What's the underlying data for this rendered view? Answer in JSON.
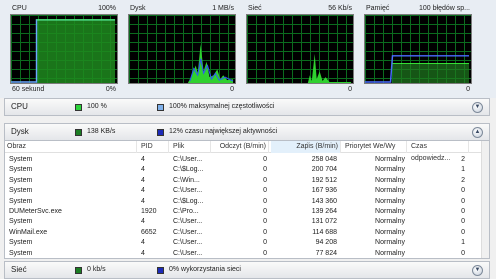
{
  "graphs": [
    {
      "title": "CPU",
      "top_right": "100%",
      "bottom_left": "60 sekund",
      "bottom_right": "0%"
    },
    {
      "title": "Dysk",
      "top_right": "1 MB/s",
      "bottom_left": "",
      "bottom_right": "0"
    },
    {
      "title": "Sieć",
      "top_right": "56 Kb/s",
      "bottom_left": "",
      "bottom_right": "0"
    },
    {
      "title": "Pamięć",
      "top_right": "100 błędów sp...",
      "bottom_left": "",
      "bottom_right": "0"
    }
  ],
  "sections": {
    "cpu": {
      "title": "CPU",
      "stat1": "100 %",
      "stat2": "100% maksymalnej częstotliwości",
      "color1": "#2bd33a",
      "color2": "#7fb0ea"
    },
    "disk": {
      "title": "Dysk",
      "stat1": "138 KB/s",
      "stat2": "12% czasu największej aktywności",
      "color1": "#1b7d23",
      "color2": "#1d2bb8"
    },
    "network": {
      "title": "Sieć",
      "stat1": "0 kb/s",
      "stat2": "0% wykorzystania sieci",
      "color1": "#1b7d23",
      "color2": "#1d2bb8"
    }
  },
  "disk_table": {
    "columns": [
      "Obraz",
      "PID",
      "Plik",
      "Odczyt (B/min)",
      "Zapis (B/min)",
      "Priorytet We/Wy",
      "Czas odpowiedz..."
    ],
    "rows": [
      [
        "System",
        "4",
        "C:\\User...",
        "0",
        "258 048",
        "Normalny",
        "2"
      ],
      [
        "System",
        "4",
        "C:\\$Log...",
        "0",
        "200 704",
        "Normalny",
        "1"
      ],
      [
        "System",
        "4",
        "C:\\Win...",
        "0",
        "192 512",
        "Normalny",
        "2"
      ],
      [
        "System",
        "4",
        "C:\\User...",
        "0",
        "167 936",
        "Normalny",
        "0"
      ],
      [
        "System",
        "4",
        "C:\\$Log...",
        "0",
        "143 360",
        "Normalny",
        "0"
      ],
      [
        "DUMeterSvc.exe",
        "1920",
        "C:\\Pro...",
        "0",
        "139 264",
        "Normalny",
        "0"
      ],
      [
        "System",
        "4",
        "C:\\User...",
        "0",
        "131 072",
        "Normalny",
        "0"
      ],
      [
        "WinMail.exe",
        "6652",
        "C:\\User...",
        "0",
        "114 688",
        "Normalny",
        "0"
      ],
      [
        "System",
        "4",
        "C:\\User...",
        "0",
        "94 208",
        "Normalny",
        "1"
      ],
      [
        "System",
        "4",
        "C:\\User...",
        "0",
        "77 824",
        "Normalny",
        "0"
      ]
    ]
  }
}
